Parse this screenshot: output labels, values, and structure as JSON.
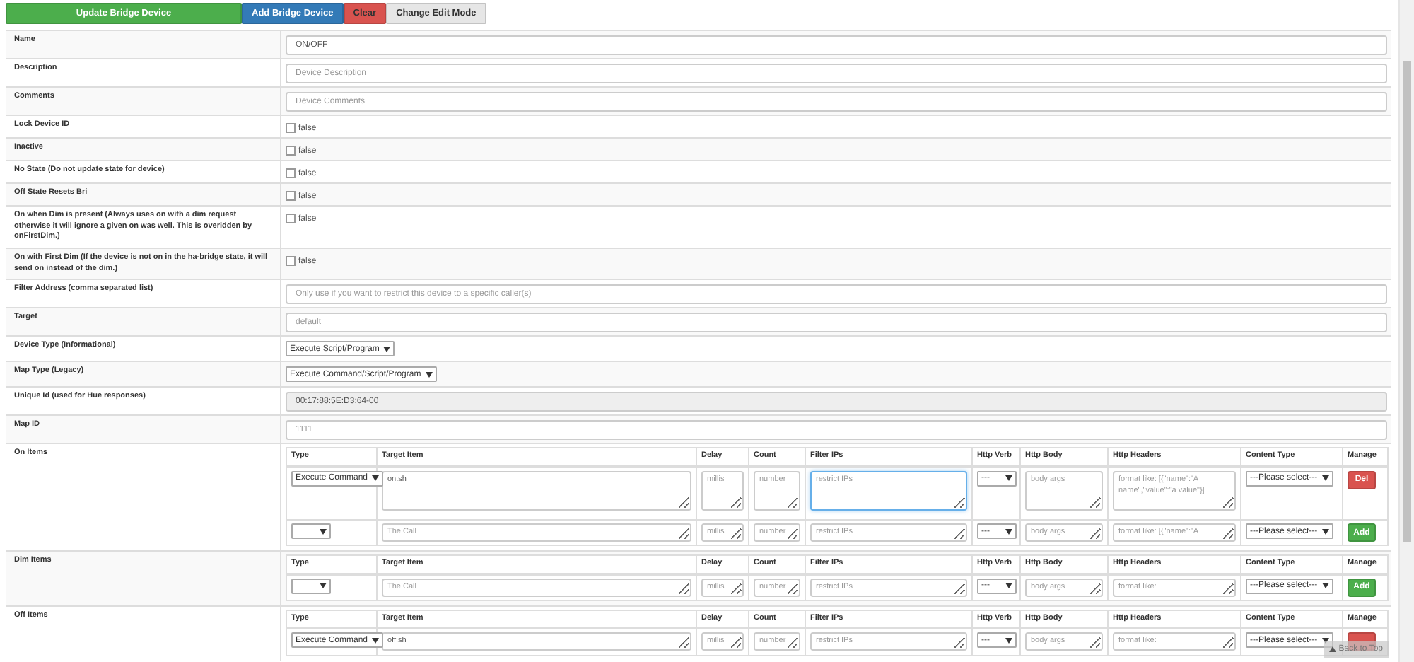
{
  "toolbar": {
    "buttons": [
      {
        "label": "Update Bridge Device",
        "color": "#4cae4c"
      },
      {
        "label": "Add Bridge Device",
        "color": "#337ab7"
      },
      {
        "label": "Clear",
        "color": "#d9534f"
      },
      {
        "label": "Change Edit Mode",
        "color": "#e6e6e6"
      }
    ]
  },
  "fields": [
    {
      "label": "Name",
      "kind": "text",
      "value": "ON/OFF"
    },
    {
      "label": "Description",
      "kind": "text",
      "placeholder": "Device Description"
    },
    {
      "label": "Comments",
      "kind": "text",
      "placeholder": "Device Comments"
    },
    {
      "label": "Lock Device ID",
      "kind": "checkbox",
      "checked": false,
      "text": "false"
    },
    {
      "label": "Inactive",
      "kind": "checkbox",
      "checked": false,
      "text": "false"
    },
    {
      "label": "No State (Do not update state for device)",
      "kind": "checkbox",
      "checked": false,
      "text": "false"
    },
    {
      "label": "Off State Resets Bri",
      "kind": "checkbox",
      "checked": false,
      "text": "false"
    },
    {
      "label": "On when Dim is present (Always uses on with a dim request otherwise it will ignore a given on was well. This is overidden by onFirstDim.)",
      "kind": "checkbox",
      "checked": false,
      "text": "false"
    },
    {
      "label": "On with First Dim (If the device is not on in the ha-bridge state, it will send on instead of the dim.)",
      "kind": "checkbox",
      "checked": false,
      "text": "false"
    },
    {
      "label": "Filter Address (comma separated list)",
      "kind": "text",
      "placeholder": "Only use if you want to restrict this device to a specific caller(s)"
    },
    {
      "label": "Target",
      "kind": "text",
      "placeholder": "default"
    },
    {
      "label": "Device Type (Informational)",
      "kind": "select",
      "value": "Execute Script/Program"
    },
    {
      "label": "Map Type (Legacy)",
      "kind": "select",
      "value": "Execute Command/Script/Program"
    },
    {
      "label": "Unique Id (used for Hue responses)",
      "kind": "readonly",
      "value": "00:17:88:5E:D3:64-00"
    },
    {
      "label": "Map ID",
      "kind": "text",
      "placeholder": "1111"
    }
  ],
  "item_tables": [
    {
      "label": "On Items",
      "columns": [
        "Type",
        "Target Item",
        "Delay",
        "Count",
        "Filter IPs",
        "Http Verb",
        "Http Body",
        "Http Headers",
        "Content Type",
        "Manage"
      ],
      "rows": [
        {
          "tall": true,
          "cells": [
            {
              "kind": "select",
              "value": "Execute Command"
            },
            {
              "kind": "textarea",
              "value": "on.sh"
            },
            {
              "kind": "textarea",
              "placeholder": "millis"
            },
            {
              "kind": "textarea",
              "placeholder": "number"
            },
            {
              "kind": "textarea",
              "placeholder": "restrict IPs",
              "focused": true
            },
            {
              "kind": "select",
              "value": "---"
            },
            {
              "kind": "textarea",
              "placeholder": "body args"
            },
            {
              "kind": "textarea",
              "placeholder": "format like: [{\"name\":\"A name\",\"value\":\"a value\"}]"
            },
            {
              "kind": "select",
              "value": "---Please select---"
            },
            {
              "kind": "button",
              "label": "Del",
              "color": "#d9534f"
            }
          ]
        },
        {
          "tall": false,
          "cells": [
            {
              "kind": "select"
            },
            {
              "kind": "textarea",
              "placeholder": "The Call"
            },
            {
              "kind": "textarea",
              "placeholder": "millis"
            },
            {
              "kind": "textarea",
              "placeholder": "number"
            },
            {
              "kind": "textarea",
              "placeholder": "restrict IPs",
              "focused": false
            },
            {
              "kind": "select",
              "value": "---"
            },
            {
              "kind": "textarea",
              "placeholder": "body args"
            },
            {
              "kind": "textarea",
              "placeholder": "format like: [{\"name\":\"A"
            },
            {
              "kind": "select",
              "value": "---Please select---"
            },
            {
              "kind": "button",
              "label": "Add",
              "color": "#4cae4c"
            }
          ]
        }
      ]
    },
    {
      "label": "Dim Items",
      "columns": [
        "Type",
        "Target Item",
        "Delay",
        "Count",
        "Filter IPs",
        "Http Verb",
        "Http Body",
        "Http Headers",
        "Content Type",
        "Manage"
      ],
      "rows": [
        {
          "tall": false,
          "cells": [
            {
              "kind": "select"
            },
            {
              "kind": "textarea",
              "placeholder": "The Call"
            },
            {
              "kind": "textarea",
              "placeholder": "millis"
            },
            {
              "kind": "textarea",
              "placeholder": "number"
            },
            {
              "kind": "textarea",
              "placeholder": "restrict IPs",
              "focused": false
            },
            {
              "kind": "select",
              "value": "---"
            },
            {
              "kind": "textarea",
              "placeholder": "body args"
            },
            {
              "kind": "textarea",
              "placeholder": "format like:"
            },
            {
              "kind": "select",
              "value": "---Please select---"
            },
            {
              "kind": "button",
              "label": "Add",
              "color": "#4cae4c"
            }
          ]
        }
      ]
    },
    {
      "label": "Off Items",
      "columns": [
        "Type",
        "Target Item",
        "Delay",
        "Count",
        "Filter IPs",
        "Http Verb",
        "Http Body",
        "Http Headers",
        "Content Type",
        "Manage"
      ],
      "rows": [
        {
          "tall": false,
          "cells": [
            {
              "kind": "select",
              "value": "Execute Command"
            },
            {
              "kind": "textarea",
              "value": "off.sh"
            },
            {
              "kind": "textarea",
              "placeholder": "millis"
            },
            {
              "kind": "textarea",
              "placeholder": "number"
            },
            {
              "kind": "textarea",
              "placeholder": "restrict IPs",
              "focused": false
            },
            {
              "kind": "select",
              "value": "---"
            },
            {
              "kind": "textarea",
              "placeholder": "body args"
            },
            {
              "kind": "textarea",
              "placeholder": "format like:"
            },
            {
              "kind": "select",
              "value": "---Please select---"
            },
            {
              "kind": "button",
              "color": "#d9534f"
            }
          ]
        }
      ]
    }
  ],
  "back_to_top": {
    "label": "Back to Top"
  }
}
